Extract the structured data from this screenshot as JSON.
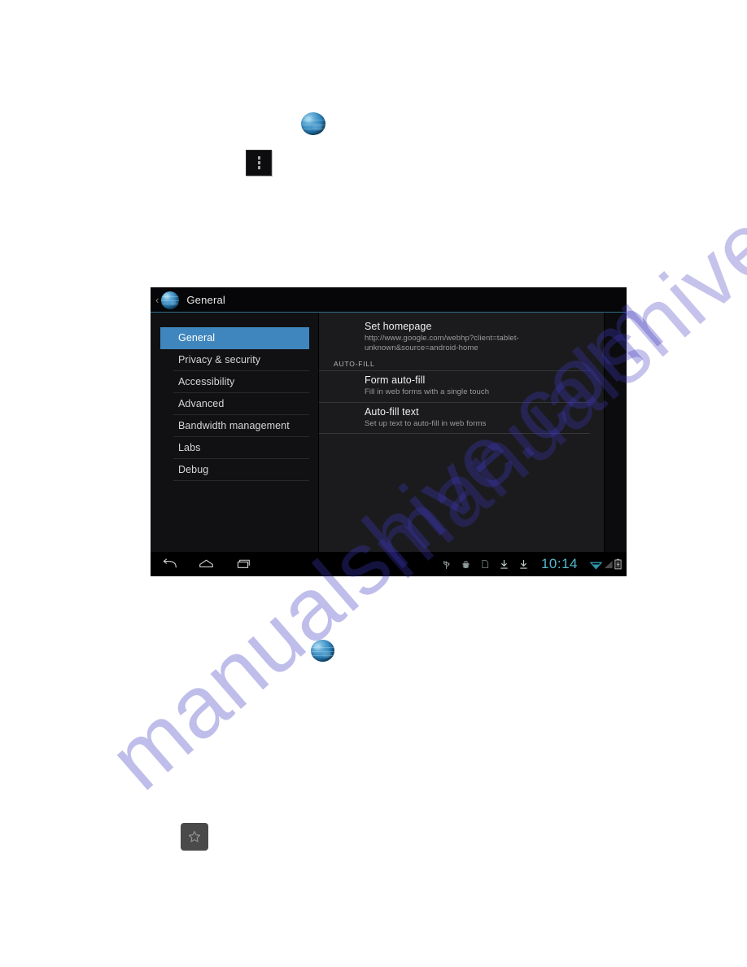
{
  "page": {
    "watermark": "manualshive.com",
    "watermark_color": "#3e38be",
    "background": "#ffffff"
  },
  "standalone_icons": {
    "browser_icon_top": "globe-browser-icon",
    "overflow_menu_button": "overflow-menu-icon",
    "browser_icon_middle": "globe-browser-icon",
    "bookmark_star_button": "star-bookmark-icon"
  },
  "tablet": {
    "header": {
      "back_label": "‹",
      "app_icon": "globe-browser-icon",
      "title": "General",
      "divider_color": "#2f6e8e"
    },
    "sidebar": {
      "selected": "General",
      "items": [
        {
          "label": "General"
        },
        {
          "label": "Privacy & security"
        },
        {
          "label": "Accessibility"
        },
        {
          "label": "Advanced"
        },
        {
          "label": "Bandwidth management"
        },
        {
          "label": "Labs"
        },
        {
          "label": "Debug"
        }
      ],
      "selected_color": "#3f86bf"
    },
    "content": {
      "prefs_top": [
        {
          "title": "Set homepage",
          "subtitle": "http://www.google.com/webhp?client=tablet-unknown&source=android-home",
          "checkbox": false
        }
      ],
      "section_header": "AUTO-FILL",
      "prefs_section": [
        {
          "title": "Form auto-fill",
          "subtitle": "Fill in web forms with a single touch",
          "checkbox": true,
          "checkbox_checked": true
        },
        {
          "title": "Auto-fill text",
          "subtitle": "Set up text to auto-fill in web forms",
          "checkbox": false
        }
      ]
    },
    "navbar": {
      "buttons": [
        {
          "name": "back",
          "icon": "back-arrow-icon"
        },
        {
          "name": "home",
          "icon": "home-icon"
        },
        {
          "name": "recents",
          "icon": "recent-apps-icon"
        }
      ],
      "status_icons": [
        {
          "name": "usb",
          "icon": "usb-icon"
        },
        {
          "name": "adb",
          "icon": "android-debug-icon"
        },
        {
          "name": "sdcard",
          "icon": "sd-card-icon"
        },
        {
          "name": "download1",
          "icon": "download-icon"
        },
        {
          "name": "download2",
          "icon": "download-icon"
        }
      ],
      "clock": "10:14",
      "clock_color": "#55b8cf",
      "system_icons": [
        {
          "name": "wifi",
          "icon": "wifi-icon"
        },
        {
          "name": "signal",
          "icon": "signal-bars-icon"
        },
        {
          "name": "battery",
          "icon": "battery-icon"
        }
      ]
    }
  }
}
